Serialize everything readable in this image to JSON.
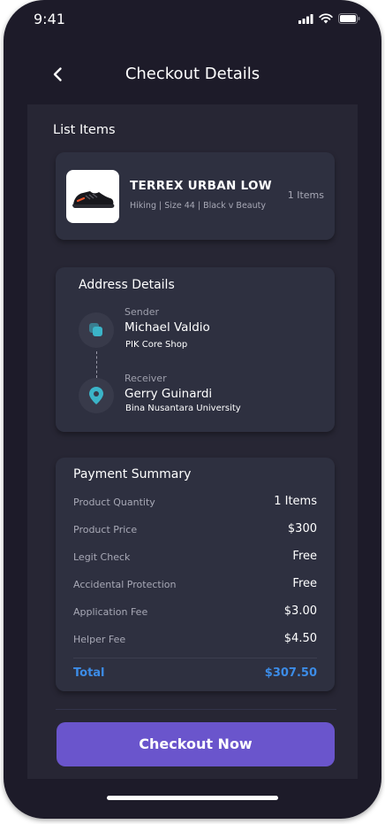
{
  "status_bar": {
    "time": "9:41",
    "icons": [
      "signal-icon",
      "wifi-icon",
      "battery-icon"
    ]
  },
  "header": {
    "title": "Checkout Details",
    "back_icon": "chevron-left-icon"
  },
  "list_items": {
    "label": "List Items",
    "product": {
      "name": "TERREX URBAN LOW",
      "description": "Hiking | Size 44 | Black v Beauty",
      "quantity": "1 Items",
      "image_icon": "shoe-icon"
    }
  },
  "address": {
    "title": "Address Details",
    "sender": {
      "role": "Sender",
      "name": "Michael Valdio",
      "place": "PIK Core Shop",
      "icon": "store-icon"
    },
    "receiver": {
      "role": "Receiver",
      "name": "Gerry Guinardi",
      "place": "Bina Nusantara University",
      "icon": "location-pin-icon"
    }
  },
  "payment": {
    "title": "Payment Summary",
    "rows": [
      {
        "label": "Product Quantity",
        "value": "1 Items"
      },
      {
        "label": "Product Price",
        "value": "$300"
      },
      {
        "label": "Legit Check",
        "value": "Free"
      },
      {
        "label": "Accidental Protection",
        "value": "Free"
      },
      {
        "label": "Application Fee",
        "value": "$3.00"
      },
      {
        "label": "Helper Fee",
        "value": "$4.50"
      }
    ],
    "total_label": "Total",
    "total_value": "$307.50"
  },
  "checkout_button": "Checkout Now",
  "colors": {
    "background": "#1d1b29",
    "panel": "#272634",
    "card": "#2e3040",
    "accent": "#6a55cc",
    "total": "#3c8ce7",
    "icon_teal": "#3bb4c8"
  }
}
